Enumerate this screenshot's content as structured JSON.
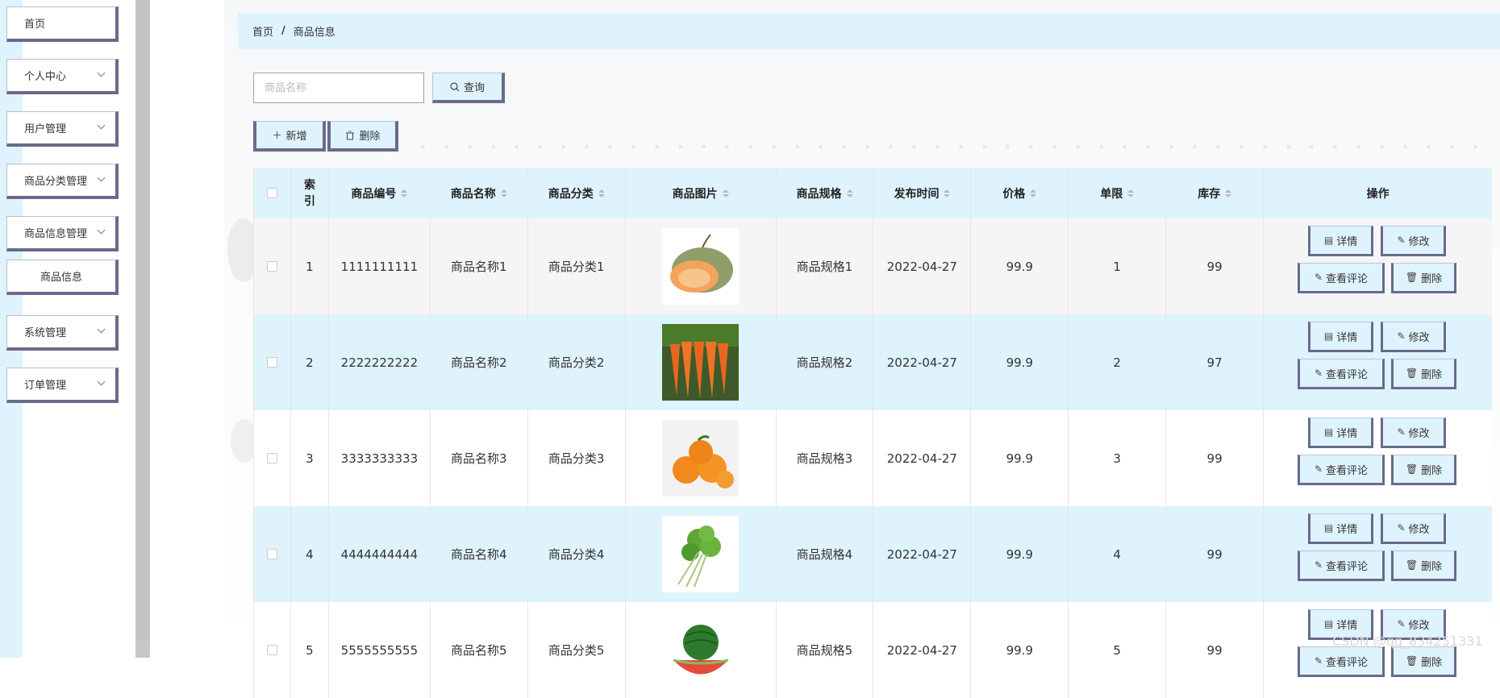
{
  "sidebar": {
    "items": [
      {
        "label": "首页",
        "has_arrow": false
      },
      {
        "label": "个人中心",
        "has_arrow": true
      },
      {
        "label": "用户管理",
        "has_arrow": true
      },
      {
        "label": "商品分类管理",
        "has_arrow": true
      },
      {
        "label": "商品信息管理",
        "has_arrow": true
      },
      {
        "label": "商品信息",
        "has_arrow": false,
        "sub": true
      },
      {
        "label": "系统管理",
        "has_arrow": true
      },
      {
        "label": "订单管理",
        "has_arrow": true
      }
    ]
  },
  "breadcrumb": {
    "home": "首页",
    "sep": "/",
    "current": "商品信息"
  },
  "search": {
    "placeholder": "商品名称",
    "button_label": "查询"
  },
  "toolbar": {
    "add_label": "新增",
    "delete_label": "删除"
  },
  "table": {
    "headers": [
      "索引",
      "商品编号",
      "商品名称",
      "商品分类",
      "商品图片",
      "商品规格",
      "发布时间",
      "价格",
      "单限",
      "库存",
      "操作"
    ],
    "rows": [
      {
        "index": "1",
        "code": "1111111111",
        "name": "商品名称1",
        "category": "商品分类1",
        "image": "cantaloupe",
        "spec": "商品规格1",
        "date": "2022-04-27",
        "price": "99.9",
        "limit": "1",
        "stock": "99"
      },
      {
        "index": "2",
        "code": "2222222222",
        "name": "商品名称2",
        "category": "商品分类2",
        "image": "carrots",
        "spec": "商品规格2",
        "date": "2022-04-27",
        "price": "99.9",
        "limit": "2",
        "stock": "97"
      },
      {
        "index": "3",
        "code": "3333333333",
        "name": "商品名称3",
        "category": "商品分类3",
        "image": "oranges",
        "spec": "商品规格3",
        "date": "2022-04-27",
        "price": "99.9",
        "limit": "3",
        "stock": "99"
      },
      {
        "index": "4",
        "code": "4444444444",
        "name": "商品名称4",
        "category": "商品分类4",
        "image": "coriander",
        "spec": "商品规格4",
        "date": "2022-04-27",
        "price": "99.9",
        "limit": "4",
        "stock": "99"
      },
      {
        "index": "5",
        "code": "5555555555",
        "name": "商品名称5",
        "category": "商品分类5",
        "image": "watermelon",
        "spec": "商品规格5",
        "date": "2022-04-27",
        "price": "99.9",
        "limit": "5",
        "stock": "99"
      }
    ],
    "actions": {
      "detail": "详情",
      "edit": "修改",
      "review": "查看评论",
      "delete": "删除"
    }
  },
  "watermark": "CSDN @qq_834251331",
  "colors": {
    "accent_bg": "#dff3fd",
    "button_shadow": "#6a6a8c",
    "sidebar_strip": "#dff3fd"
  }
}
